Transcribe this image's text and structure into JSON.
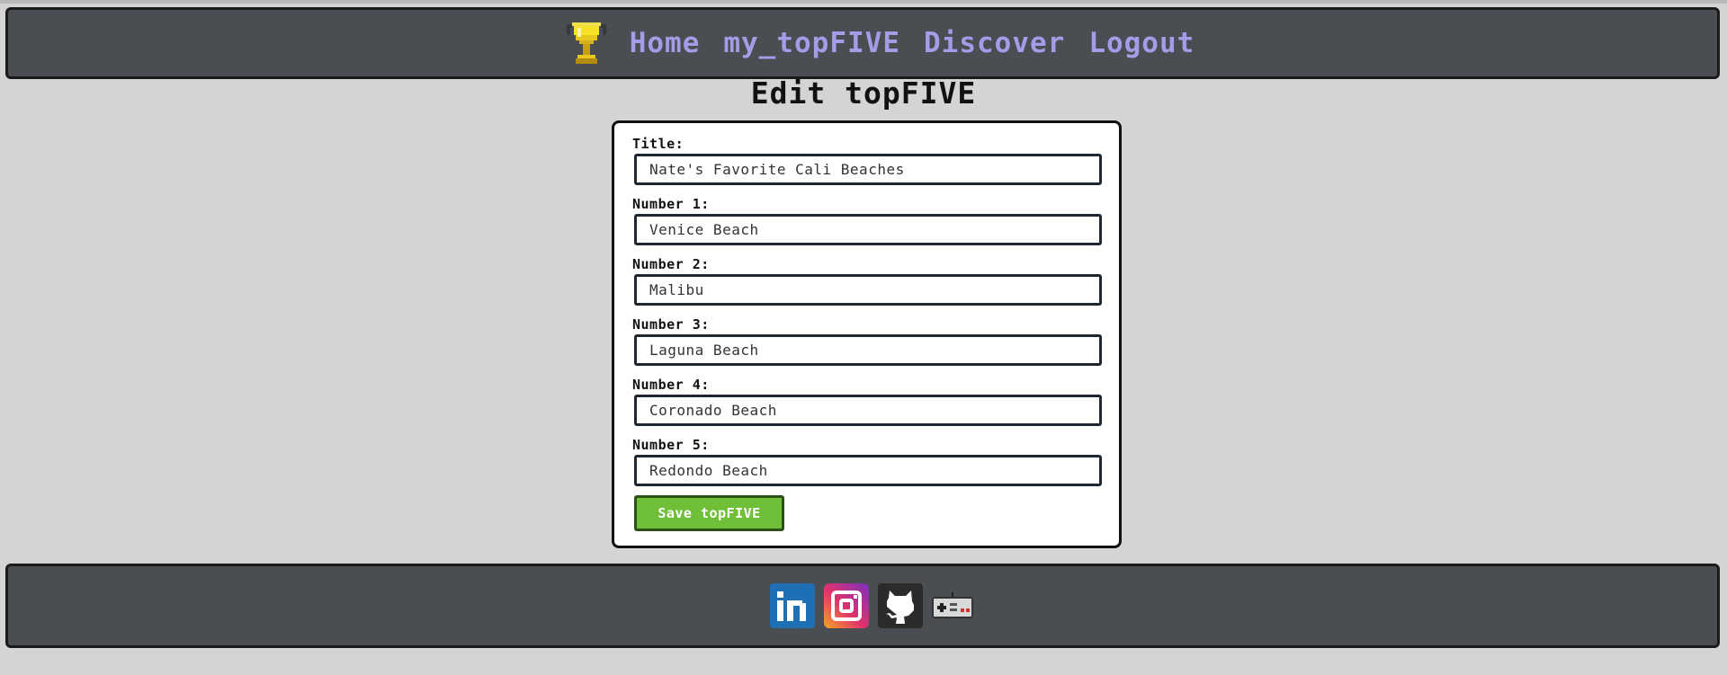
{
  "nav": {
    "icon": "trophy-icon",
    "links": [
      "Home",
      "my_topFIVE",
      "Discover",
      "Logout"
    ]
  },
  "page_title": "Edit topFIVE",
  "form": {
    "fields": [
      {
        "label": "Title:",
        "value": "Nate's Favorite Cali Beaches"
      },
      {
        "label": "Number 1:",
        "value": "Venice Beach"
      },
      {
        "label": "Number 2:",
        "value": "Malibu"
      },
      {
        "label": "Number 3:",
        "value": "Laguna Beach"
      },
      {
        "label": "Number 4:",
        "value": "Coronado Beach"
      },
      {
        "label": "Number 5:",
        "value": "Redondo Beach"
      }
    ],
    "submit_label": "Save topFIVE"
  },
  "footer": {
    "icons": [
      "linkedin-icon",
      "instagram-icon",
      "github-icon",
      "gamepad-icon"
    ]
  },
  "colors": {
    "background": "#d4d4d4",
    "bar": "#4a4d51",
    "nav_link": "#a59be6",
    "save_button": "#6fbf39"
  }
}
